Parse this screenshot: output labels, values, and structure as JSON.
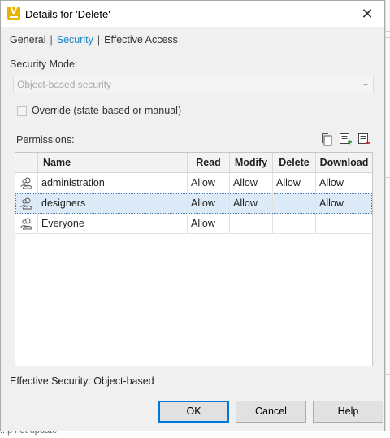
{
  "window": {
    "title": "Details for 'Delete'"
  },
  "tabs": {
    "general": "General",
    "security": "Security",
    "effective_access": "Effective Access",
    "separator": "|"
  },
  "security_mode": {
    "label": "Security Mode:",
    "value": "Object-based security"
  },
  "override": {
    "label": "Override (state-based or manual)",
    "checked": false
  },
  "permissions": {
    "label": "Permissions:",
    "toolbar": [
      "copy-icon",
      "add-permission-icon",
      "remove-permission-icon"
    ],
    "columns": [
      "Name",
      "Read",
      "Modify",
      "Delete",
      "Download"
    ],
    "rows": [
      {
        "name": "administration",
        "read": "Allow",
        "modify": "Allow",
        "delete": "Allow",
        "download": "Allow"
      },
      {
        "name": "designers",
        "read": "Allow",
        "modify": "Allow",
        "delete": "",
        "download": "Allow",
        "selected": true
      },
      {
        "name": "Everyone",
        "read": "Allow",
        "modify": "",
        "delete": "",
        "download": ""
      }
    ]
  },
  "effective_security": "Effective Security: Object-based",
  "buttons": {
    "ok": "OK",
    "cancel": "Cancel",
    "help": "Help"
  },
  "background_text": "...p  not  update",
  "colors": {
    "accent": "#0078d7",
    "link_active": "#1a86c8",
    "selection": "#dcebf7"
  }
}
